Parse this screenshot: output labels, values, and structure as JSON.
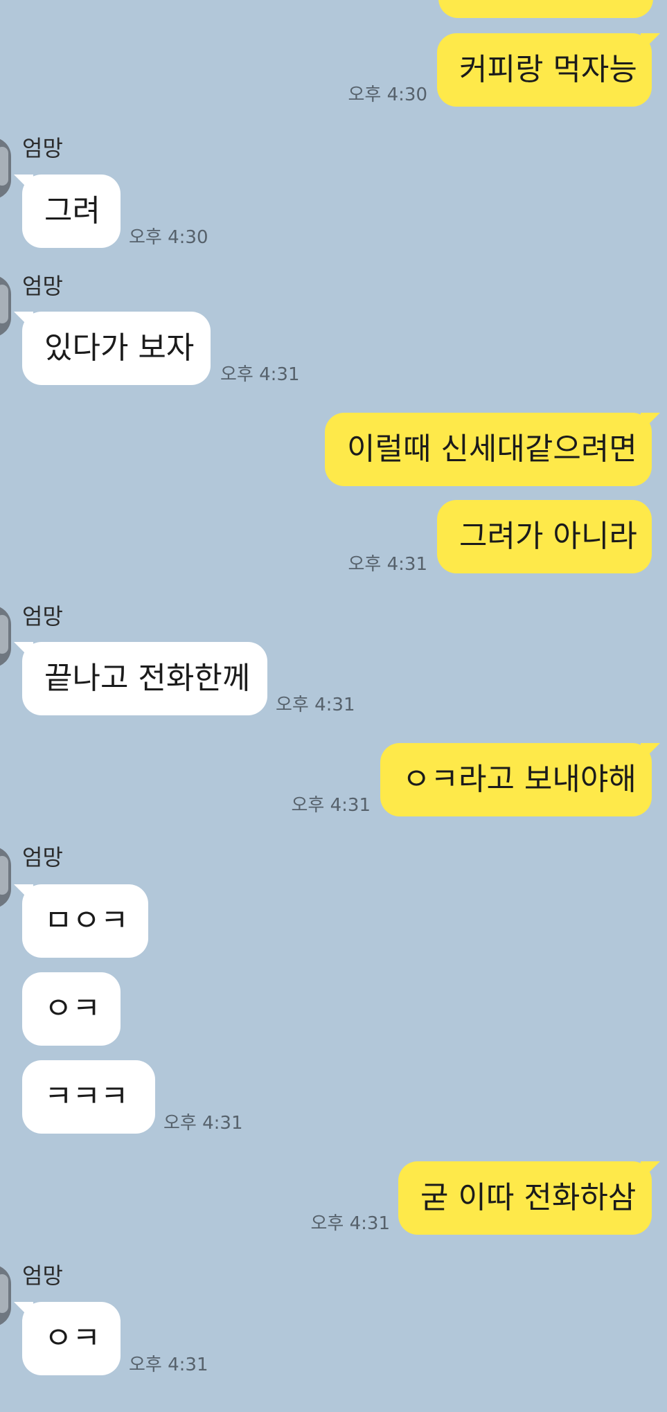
{
  "sender_name": "엄망",
  "messages": [
    {
      "text": "",
      "time": ""
    },
    {
      "text": "커피랑 먹자능",
      "time": "오후 4:30"
    },
    {
      "text": "그려",
      "time": "오후 4:30"
    },
    {
      "text": "있다가 보자",
      "time": "오후 4:31"
    },
    {
      "text": "이럴때 신세대같으려면",
      "time": ""
    },
    {
      "text": "그려가 아니라",
      "time": "오후 4:31"
    },
    {
      "text": "끝나고 전화한께",
      "time": "오후 4:31"
    },
    {
      "text": "ㅇㅋ라고 보내야해",
      "time": "오후 4:31"
    },
    {
      "text": "ㅁㅇㅋ",
      "time": ""
    },
    {
      "text": "ㅇㅋ",
      "time": ""
    },
    {
      "text": "ㅋㅋㅋ",
      "time": "오후 4:31"
    },
    {
      "text": "굳 이따 전화하삼",
      "time": "오후 4:31"
    },
    {
      "text": "ㅇㅋ",
      "time": "오후 4:31"
    }
  ],
  "colors": {
    "background": "#b2c7d9",
    "my_bubble": "#fee94a",
    "other_bubble": "#ffffff",
    "time_text": "#56616b"
  }
}
